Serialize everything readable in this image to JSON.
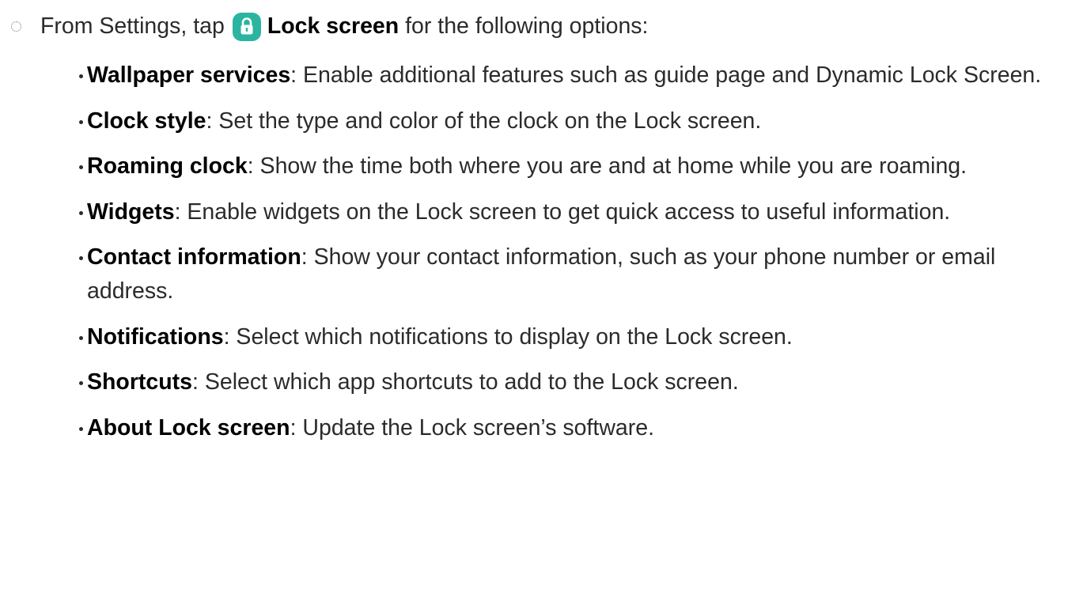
{
  "intro": {
    "prefix": "From Settings, tap",
    "link": "Lock screen",
    "suffix": "for the following options:",
    "icon": "lock-icon",
    "icon_color": "#2bb5a0"
  },
  "options": [
    {
      "term": "Wallpaper services",
      "desc": ": Enable additional features such as guide page and Dynamic Lock Screen."
    },
    {
      "term": "Clock style",
      "desc": ": Set the type and color of the clock on the Lock screen."
    },
    {
      "term": "Roaming clock",
      "desc": ": Show the time both where you are and at home while you are roaming."
    },
    {
      "term": "Widgets",
      "desc": ": Enable widgets on the Lock screen to get quick access to useful information."
    },
    {
      "term": "Contact information",
      "desc": ": Show your contact information, such as your phone number or email address."
    },
    {
      "term": "Notifications",
      "desc": ": Select which notifications to display on the Lock screen."
    },
    {
      "term": "Shortcuts",
      "desc": ": Select which app shortcuts to add to the Lock screen."
    },
    {
      "term": "About Lock screen",
      "desc": ": Update the Lock screen’s software."
    }
  ]
}
